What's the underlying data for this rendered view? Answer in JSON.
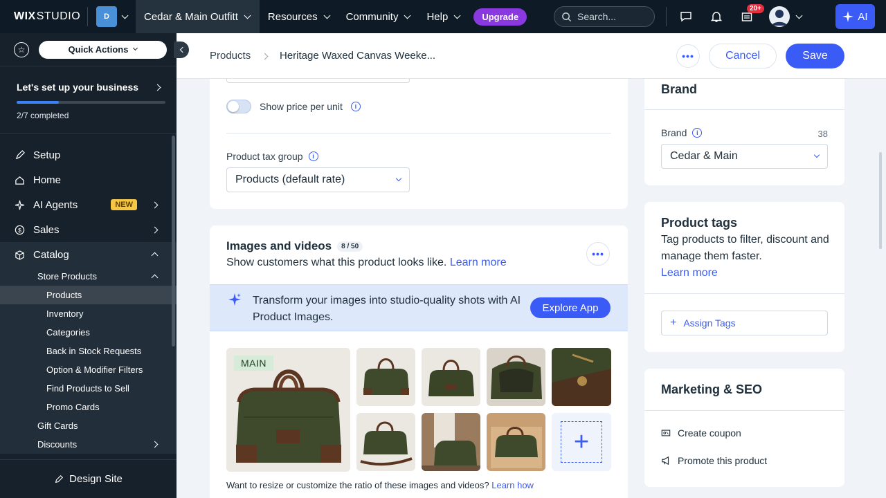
{
  "topbar": {
    "logo_bold": "WIX",
    "logo_light": "STUDIO",
    "site_initial": "D",
    "site_name": "Cedar & Main Outfitt",
    "nav": [
      "Resources",
      "Community",
      "Help"
    ],
    "upgrade": "Upgrade",
    "search_placeholder": "Search...",
    "notifications_badge": "20+",
    "ai_label": "AI"
  },
  "sidebar": {
    "quick_actions": "Quick Actions",
    "setup_title": "Let's set up your business",
    "setup_progress": "2/7 completed",
    "setup_fraction": 0.2857,
    "items": [
      {
        "label": "Setup",
        "icon": "rocket-icon"
      },
      {
        "label": "Home",
        "icon": "home-icon"
      },
      {
        "label": "AI Agents",
        "icon": "ai-agents-icon",
        "badge": "NEW"
      },
      {
        "label": "Sales",
        "icon": "dollar-icon"
      },
      {
        "label": "Catalog",
        "icon": "catalog-icon"
      }
    ],
    "store_products": "Store Products",
    "store_sub": [
      "Products",
      "Inventory",
      "Categories",
      "Back in Stock Requests",
      "Option & Modifier Filters",
      "Find Products to Sell",
      "Promo Cards"
    ],
    "gift_cards": "Gift Cards",
    "discounts": "Discounts",
    "design_site": "Design Site"
  },
  "header": {
    "crumb_root": "Products",
    "crumb_current": "Heritage Waxed Canvas Weeke...",
    "cancel": "Cancel",
    "save": "Save"
  },
  "pricing": {
    "price_per_unit": "Show price per unit",
    "tax_group_label": "Product tax group",
    "tax_group_value": "Products (default rate)"
  },
  "media": {
    "title": "Images and videos",
    "count": "8 / 50",
    "subtitle": "Show customers what this product looks like.",
    "learn_more": "Learn more",
    "ai_banner": "Transform your images into studio-quality shots with AI Product Images.",
    "explore_app": "Explore App",
    "main_badge": "MAIN",
    "resize_note": "Want to resize or customize the ratio of these images and videos?",
    "learn_how": "Learn how"
  },
  "brand": {
    "section_title": "Brand",
    "field_label": "Brand",
    "char_count": "38",
    "value": "Cedar & Main"
  },
  "tags": {
    "title": "Product tags",
    "description": "Tag products to filter, discount and manage them faster.",
    "learn_more": "Learn more",
    "assign": "Assign Tags"
  },
  "seo": {
    "title": "Marketing & SEO",
    "create_coupon": "Create coupon",
    "promote": "Promote this product"
  }
}
